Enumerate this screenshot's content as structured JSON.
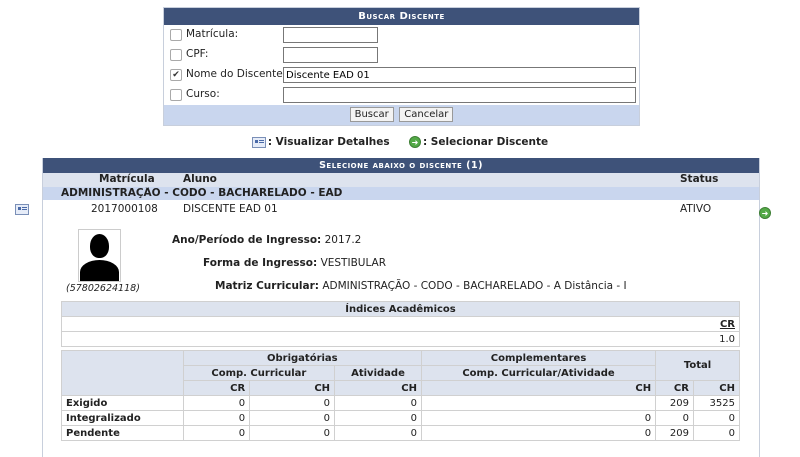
{
  "search": {
    "title": "Buscar Discente",
    "fields": [
      {
        "label": "Matrícula:",
        "value": "",
        "checked": false
      },
      {
        "label": "CPF:",
        "value": "",
        "checked": false
      },
      {
        "label": "Nome do Discente:",
        "value": "Discente EAD 01",
        "checked": true
      },
      {
        "label": "Curso:",
        "value": "",
        "checked": false
      }
    ],
    "buttons": {
      "search": "Buscar",
      "cancel": "Cancelar"
    }
  },
  "legend": {
    "details": ": Visualizar Detalhes",
    "select": ": Selecionar Discente"
  },
  "results": {
    "title": "Selecione abaixo o discente (1)",
    "headers": {
      "matricula": "Matrícula",
      "aluno": "Aluno",
      "status": "Status"
    },
    "group": "ADMINISTRAÇÃO - CODO - BACHARELADO - EAD",
    "student": {
      "matricula": "2017000108",
      "nome": "DISCENTE EAD 01",
      "status": "ATIVO",
      "cpf": "(57802624118)",
      "ingresso_label": "Ano/Período de Ingresso:",
      "ingresso_value": "2017.2",
      "forma_label": "Forma de Ingresso:",
      "forma_value": "VESTIBULAR",
      "matriz_label": "Matriz Curricular:",
      "matriz_value": "ADMINISTRAÇÃO - CODO - BACHARELADO - A Distância - I"
    },
    "indices": {
      "title": "Índices Acadêmicos",
      "col": "CR",
      "value": "1.0"
    },
    "totals": {
      "h_obrig": "Obrigatórias",
      "h_compl": "Complementares",
      "h_total": "Total",
      "h_comp_curr": "Comp. Curricular",
      "h_atividade": "Atividade",
      "h_comp_ativ": "Comp. Curricular/Atividade",
      "cr": "CR",
      "ch": "CH",
      "rows": [
        {
          "label": "Exigido",
          "v": [
            "0",
            "0",
            "0",
            "",
            "209",
            "3525"
          ]
        },
        {
          "label": "Integralizado",
          "v": [
            "0",
            "0",
            "0",
            "0",
            "0",
            "0"
          ]
        },
        {
          "label": "Pendente",
          "v": [
            "0",
            "0",
            "0",
            "0",
            "209",
            "0"
          ]
        }
      ]
    }
  }
}
